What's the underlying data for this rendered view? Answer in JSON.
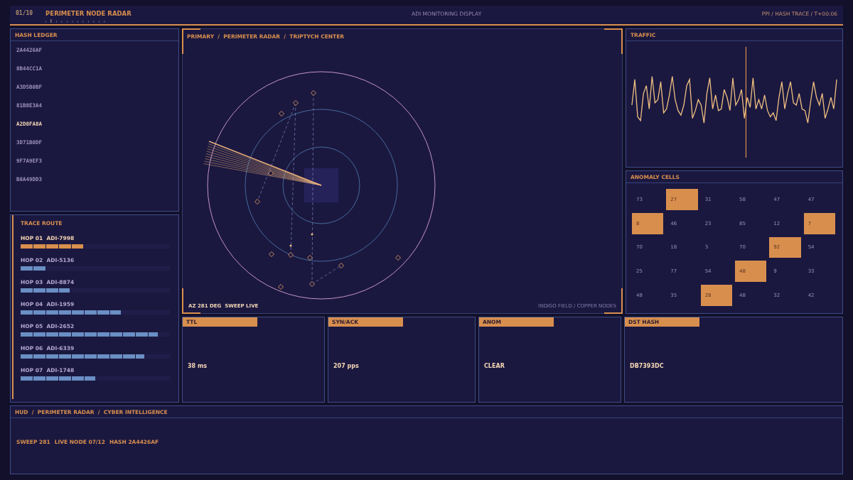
{
  "header": {
    "index": "01/10",
    "title": "PERIMETER NODE RADAR",
    "subtitle": "ADI MONITORING DISPLAY",
    "mode": "PPI / HASH TRACE / T+00:06"
  },
  "hash_ledger": {
    "title": "HASH LEDGER",
    "items": [
      {
        "hash": "2A4426AF",
        "selected": false
      },
      {
        "hash": "8B44CC1A",
        "selected": false
      },
      {
        "hash": "A3D5B0BF",
        "selected": false
      },
      {
        "hash": "81B8E3A4",
        "selected": false
      },
      {
        "hash": "A2D8FA8A",
        "selected": true
      },
      {
        "hash": "3D71B0DF",
        "selected": false
      },
      {
        "hash": "9F7A9EF3",
        "selected": false
      },
      {
        "hash": "B8A49DD3",
        "selected": false
      }
    ]
  },
  "trace_route": {
    "title": "TRACE ROUTE",
    "hops": [
      {
        "hop": "HOP 01",
        "node": "ADI-7998",
        "level": 0.42,
        "selected": true
      },
      {
        "hop": "HOP 02",
        "node": "ADI-5136",
        "level": 0.17,
        "selected": false
      },
      {
        "hop": "HOP 03",
        "node": "ADI-8874",
        "level": 0.33,
        "selected": false
      },
      {
        "hop": "HOP 04",
        "node": "ADI-1959",
        "level": 0.67,
        "selected": false
      },
      {
        "hop": "HOP 05",
        "node": "ADI-2652",
        "level": 0.92,
        "selected": false
      },
      {
        "hop": "HOP 06",
        "node": "ADI-6339",
        "level": 0.83,
        "selected": false
      },
      {
        "hop": "HOP 07",
        "node": "ADI-1748",
        "level": 0.5,
        "selected": false
      }
    ]
  },
  "radar": {
    "breadcrumb": "PRIMARY  /  PERIMETER RADAR  /  TRIPTYCH CENTER",
    "azimuth": "AZ 281 DEG",
    "status": "SWEEP LIVE",
    "legend": "INDIGO FIELD / COPPER NODES"
  },
  "traffic": {
    "title": "TRAFFIC"
  },
  "anomaly_cells": {
    "title": "ANOMALY CELLS",
    "cells": [
      {
        "value": "73",
        "hot": false
      },
      {
        "value": "27",
        "hot": true
      },
      {
        "value": "31",
        "hot": false
      },
      {
        "value": "58",
        "hot": false
      },
      {
        "value": "47",
        "hot": false
      },
      {
        "value": "47",
        "hot": false
      },
      {
        "value": "8",
        "hot": true
      },
      {
        "value": "46",
        "hot": false
      },
      {
        "value": "23",
        "hot": false
      },
      {
        "value": "85",
        "hot": false
      },
      {
        "value": "12",
        "hot": false
      },
      {
        "value": "7",
        "hot": true
      },
      {
        "value": "70",
        "hot": false
      },
      {
        "value": "18",
        "hot": false
      },
      {
        "value": "3",
        "hot": false
      },
      {
        "value": "70",
        "hot": false
      },
      {
        "value": "92",
        "hot": true
      },
      {
        "value": "54",
        "hot": false
      },
      {
        "value": "25",
        "hot": false
      },
      {
        "value": "77",
        "hot": false
      },
      {
        "value": "54",
        "hot": false
      },
      {
        "value": "48",
        "hot": true
      },
      {
        "value": "9",
        "hot": false
      },
      {
        "value": "33",
        "hot": false
      },
      {
        "value": "48",
        "hot": false
      },
      {
        "value": "35",
        "hot": false
      },
      {
        "value": "28",
        "hot": true
      },
      {
        "value": "48",
        "hot": false
      },
      {
        "value": "32",
        "hot": false
      },
      {
        "value": "42",
        "hot": false
      }
    ]
  },
  "metrics": [
    {
      "label": "TTL",
      "value": "38 ms"
    },
    {
      "label": "SYN/ACK",
      "value": "207 pps"
    },
    {
      "label": "ANOM",
      "value": "CLEAR"
    },
    {
      "label": "DST HASH",
      "value": "DB7393DC"
    }
  ],
  "footer": {
    "breadcrumb": "HUD  /  PERIMETER RADAR  /  CYBER INTELLIGENCE",
    "status": [
      "SWEEP 281",
      "LIVE NODE 07/12",
      "HASH 2A4426AF"
    ]
  }
}
